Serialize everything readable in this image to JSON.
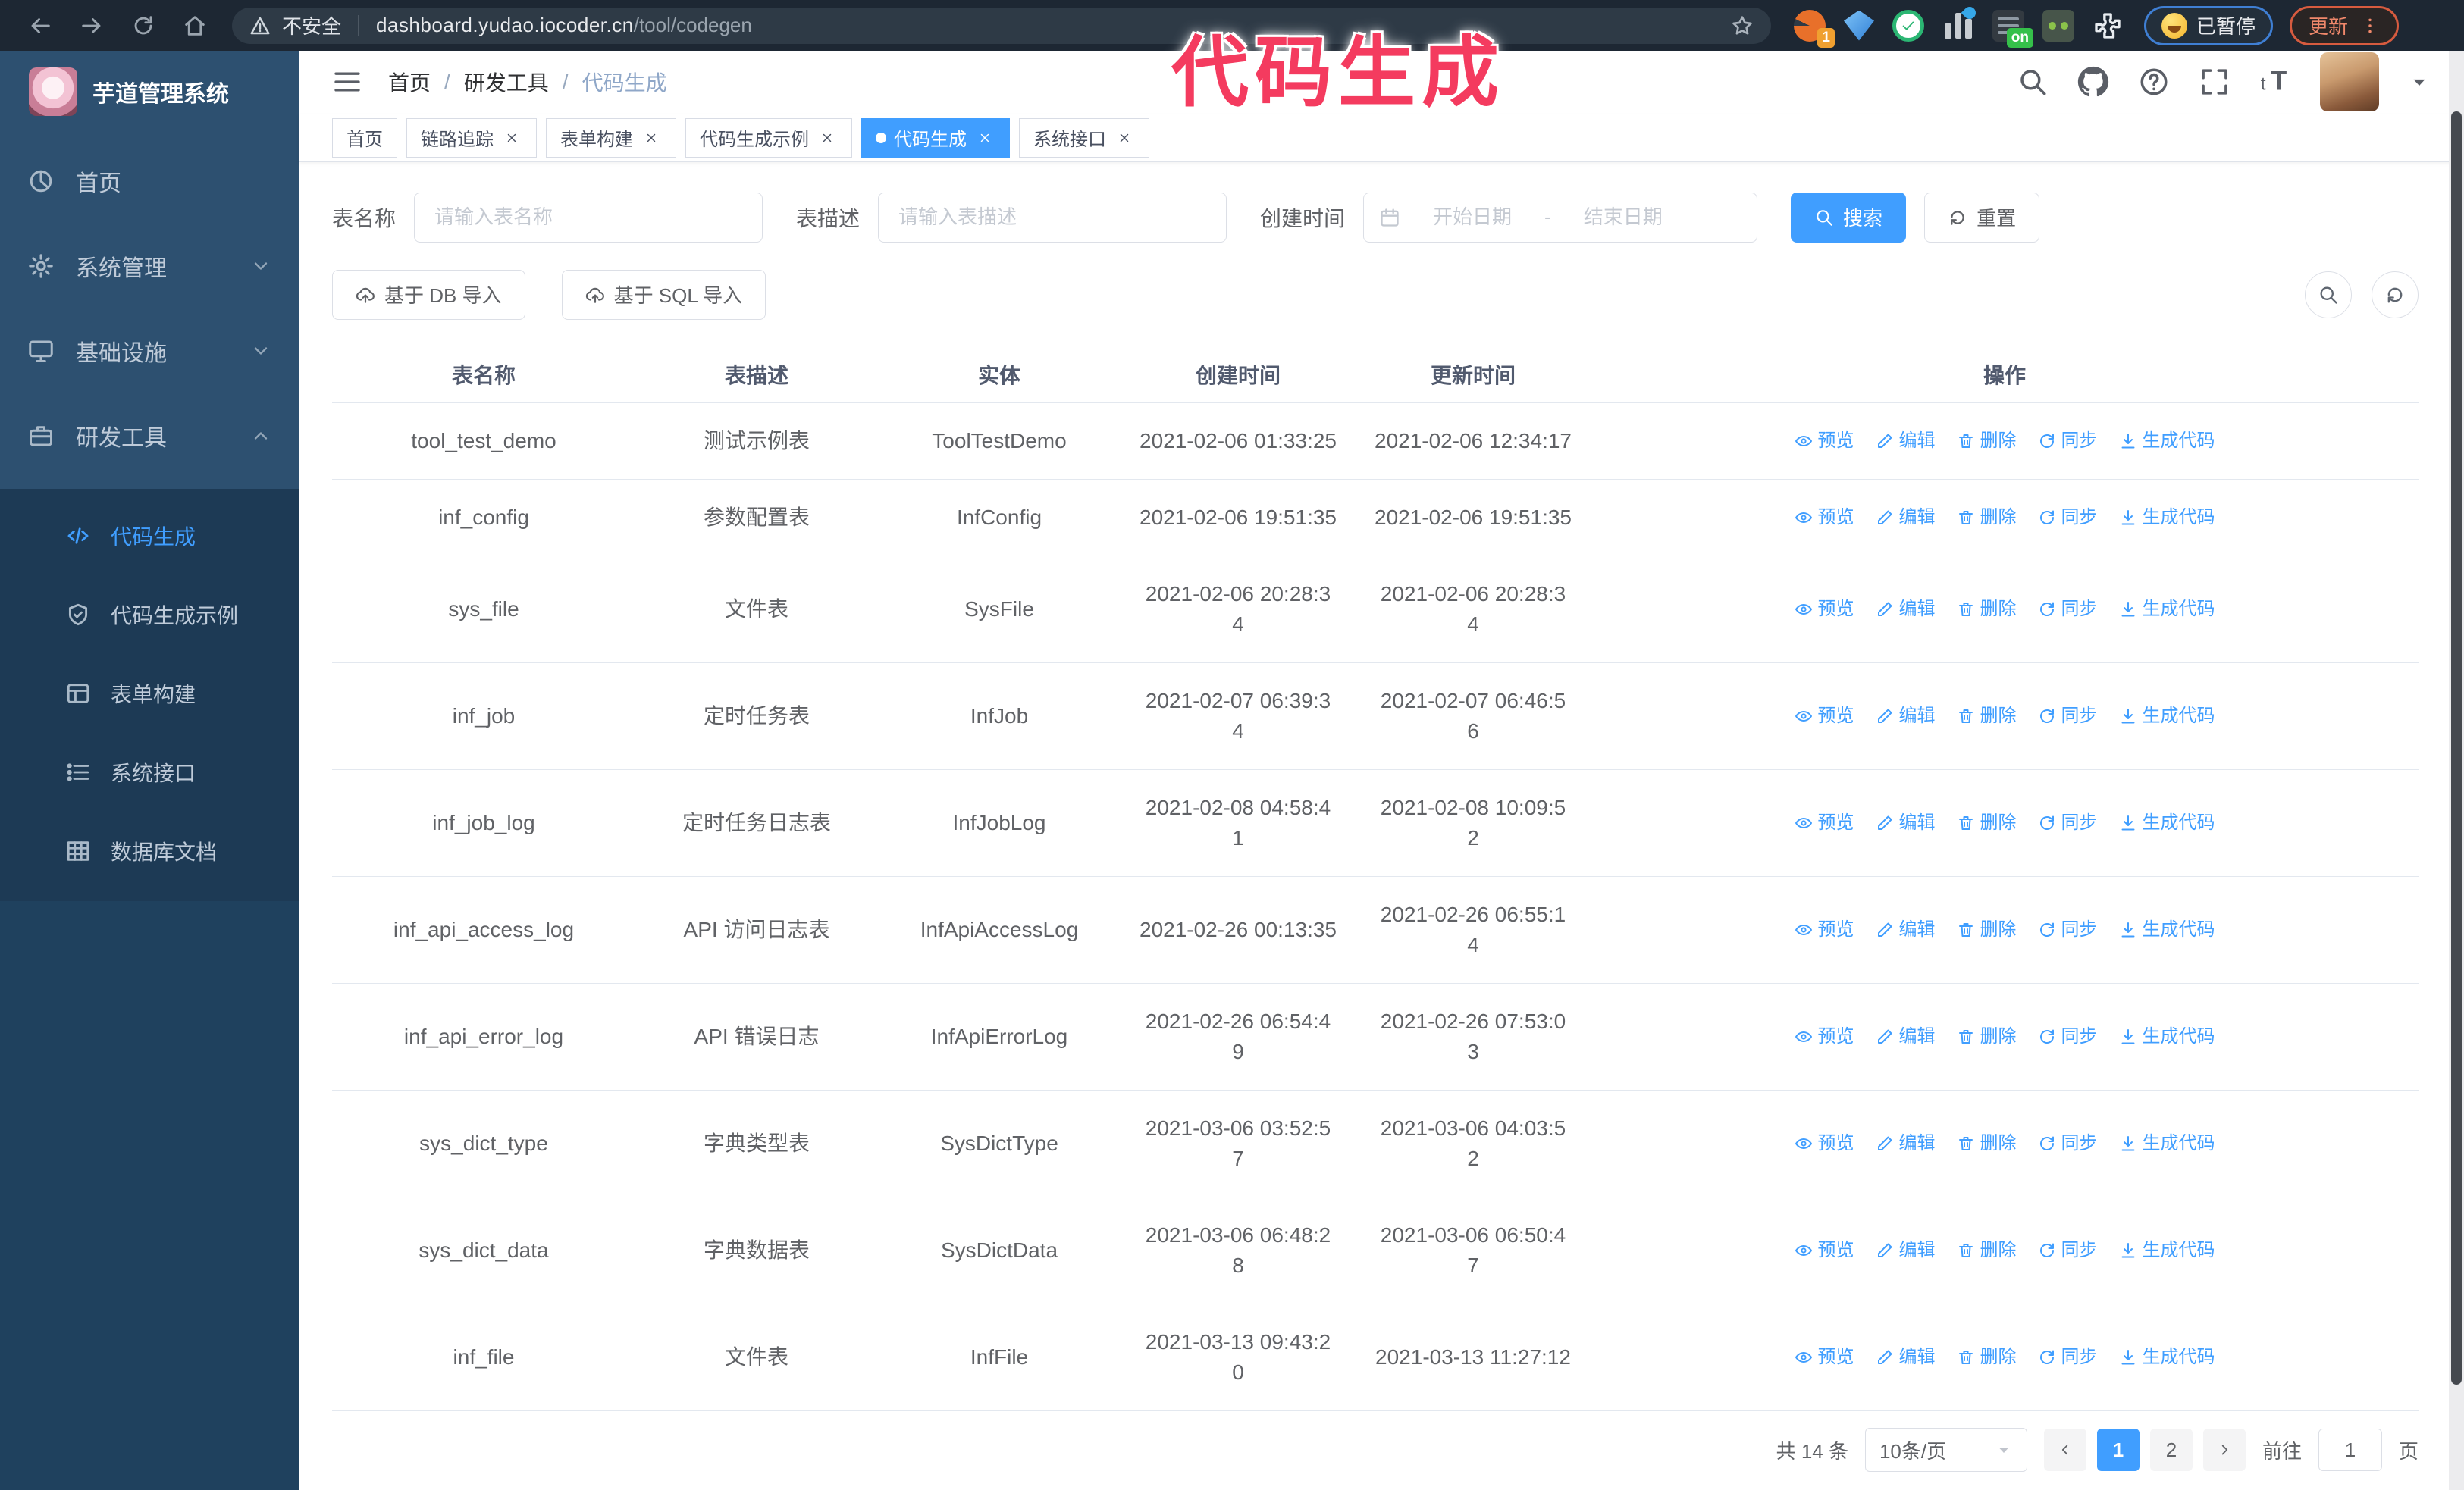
{
  "overlay": {
    "text": "代码生成",
    "color": "#f43b5f"
  },
  "browser": {
    "nav_icons": [
      "back-icon",
      "forward-icon",
      "reload-icon",
      "home-icon"
    ],
    "security_label": "不安全",
    "url_domain": "dashboard.yudao.iocoder.cn",
    "url_path": "/tool/codegen",
    "star_icon": "star-icon",
    "extensions": [
      {
        "name": "adblock-extension-icon",
        "badge": "1"
      },
      {
        "name": "gem-extension-icon"
      },
      {
        "name": "check-extension-icon"
      },
      {
        "name": "columns-extension-icon"
      },
      {
        "name": "dark-extension-icon",
        "badge": "on"
      },
      {
        "name": "monkey-extension-icon"
      },
      {
        "name": "puzzle-extension-icon"
      }
    ],
    "paused_pill": "已暂停",
    "update_button": "更新"
  },
  "sidebar": {
    "logo_title": "芋道管理系统",
    "items": [
      {
        "icon": "dashboard-icon",
        "label": "首页",
        "chevron": null
      },
      {
        "icon": "gear-icon",
        "label": "系统管理",
        "chevron": "down"
      },
      {
        "icon": "infra-icon",
        "label": "基础设施",
        "chevron": "down"
      },
      {
        "icon": "tools-icon",
        "label": "研发工具",
        "chevron": "up"
      }
    ],
    "submenu": [
      {
        "icon": "code-icon",
        "label": "代码生成",
        "active": true
      },
      {
        "icon": "shield-icon",
        "label": "代码生成示例",
        "active": false
      },
      {
        "icon": "form-icon",
        "label": "表单构建",
        "active": false
      },
      {
        "icon": "api-icon",
        "label": "系统接口",
        "active": false
      },
      {
        "icon": "db-doc-icon",
        "label": "数据库文档",
        "active": false
      }
    ]
  },
  "header": {
    "breadcrumb": [
      "首页",
      "研发工具",
      "代码生成"
    ],
    "icons": [
      "search-icon",
      "github-icon",
      "question-icon",
      "fullscreen-icon",
      "font-size-icon"
    ]
  },
  "tabs": [
    {
      "label": "首页",
      "closable": false,
      "active": false
    },
    {
      "label": "链路追踪",
      "closable": true,
      "active": false
    },
    {
      "label": "表单构建",
      "closable": true,
      "active": false
    },
    {
      "label": "代码生成示例",
      "closable": true,
      "active": false
    },
    {
      "label": "代码生成",
      "closable": true,
      "active": true
    },
    {
      "label": "系统接口",
      "closable": true,
      "active": false
    }
  ],
  "filters": {
    "name_label": "表名称",
    "name_placeholder": "请输入表名称",
    "desc_label": "表描述",
    "desc_placeholder": "请输入表描述",
    "time_label": "创建时间",
    "start_placeholder": "开始日期",
    "range_separator": "-",
    "end_placeholder": "结束日期",
    "search_label": "搜索",
    "reset_label": "重置"
  },
  "import_buttons": [
    {
      "icon": "upload-icon",
      "label": "基于 DB 导入"
    },
    {
      "icon": "upload-icon",
      "label": "基于 SQL 导入"
    }
  ],
  "toolbar_circle_buttons": [
    "search-icon",
    "refresh-icon"
  ],
  "table": {
    "headers": [
      "表名称",
      "表描述",
      "实体",
      "创建时间",
      "更新时间",
      "操作"
    ],
    "row_actions": [
      {
        "icon": "eye-icon",
        "label": "预览"
      },
      {
        "icon": "edit-icon",
        "label": "编辑"
      },
      {
        "icon": "delete-icon",
        "label": "删除"
      },
      {
        "icon": "sync-icon",
        "label": "同步"
      },
      {
        "icon": "download-icon",
        "label": "生成代码"
      }
    ],
    "rows": [
      {
        "name": "tool_test_demo",
        "desc": "测试示例表",
        "entity": "ToolTestDemo",
        "created": "2021-02-06 01:33:25",
        "updated": "2021-02-06 12:34:17"
      },
      {
        "name": "inf_config",
        "desc": "参数配置表",
        "entity": "InfConfig",
        "created": "2021-02-06 19:51:35",
        "updated": "2021-02-06 19:51:35"
      },
      {
        "name": "sys_file",
        "desc": "文件表",
        "entity": "SysFile",
        "created": "2021-02-06 20:28:3\n4",
        "updated": "2021-02-06 20:28:3\n4"
      },
      {
        "name": "inf_job",
        "desc": "定时任务表",
        "entity": "InfJob",
        "created": "2021-02-07 06:39:3\n4",
        "updated": "2021-02-07 06:46:5\n6"
      },
      {
        "name": "inf_job_log",
        "desc": "定时任务日志表",
        "entity": "InfJobLog",
        "created": "2021-02-08 04:58:4\n1",
        "updated": "2021-02-08 10:09:5\n2"
      },
      {
        "name": "inf_api_access_log",
        "desc": "API 访问日志表",
        "entity": "InfApiAccessLog",
        "created": "2021-02-26 00:13:35",
        "updated": "2021-02-26 06:55:1\n4"
      },
      {
        "name": "inf_api_error_log",
        "desc": "API 错误日志",
        "entity": "InfApiErrorLog",
        "created": "2021-02-26 06:54:4\n9",
        "updated": "2021-02-26 07:53:0\n3"
      },
      {
        "name": "sys_dict_type",
        "desc": "字典类型表",
        "entity": "SysDictType",
        "created": "2021-03-06 03:52:5\n7",
        "updated": "2021-03-06 04:03:5\n2"
      },
      {
        "name": "sys_dict_data",
        "desc": "字典数据表",
        "entity": "SysDictData",
        "created": "2021-03-06 06:48:2\n8",
        "updated": "2021-03-06 06:50:4\n7"
      },
      {
        "name": "inf_file",
        "desc": "文件表",
        "entity": "InfFile",
        "created": "2021-03-13 09:43:2\n0",
        "updated": "2021-03-13 11:27:12"
      }
    ]
  },
  "pagination": {
    "total": "共 14 条",
    "page_size": "10条/页",
    "pages": [
      "1",
      "2"
    ],
    "current_page": "1",
    "goto_label": "前往",
    "goto_value": "1",
    "goto_unit": "页"
  }
}
